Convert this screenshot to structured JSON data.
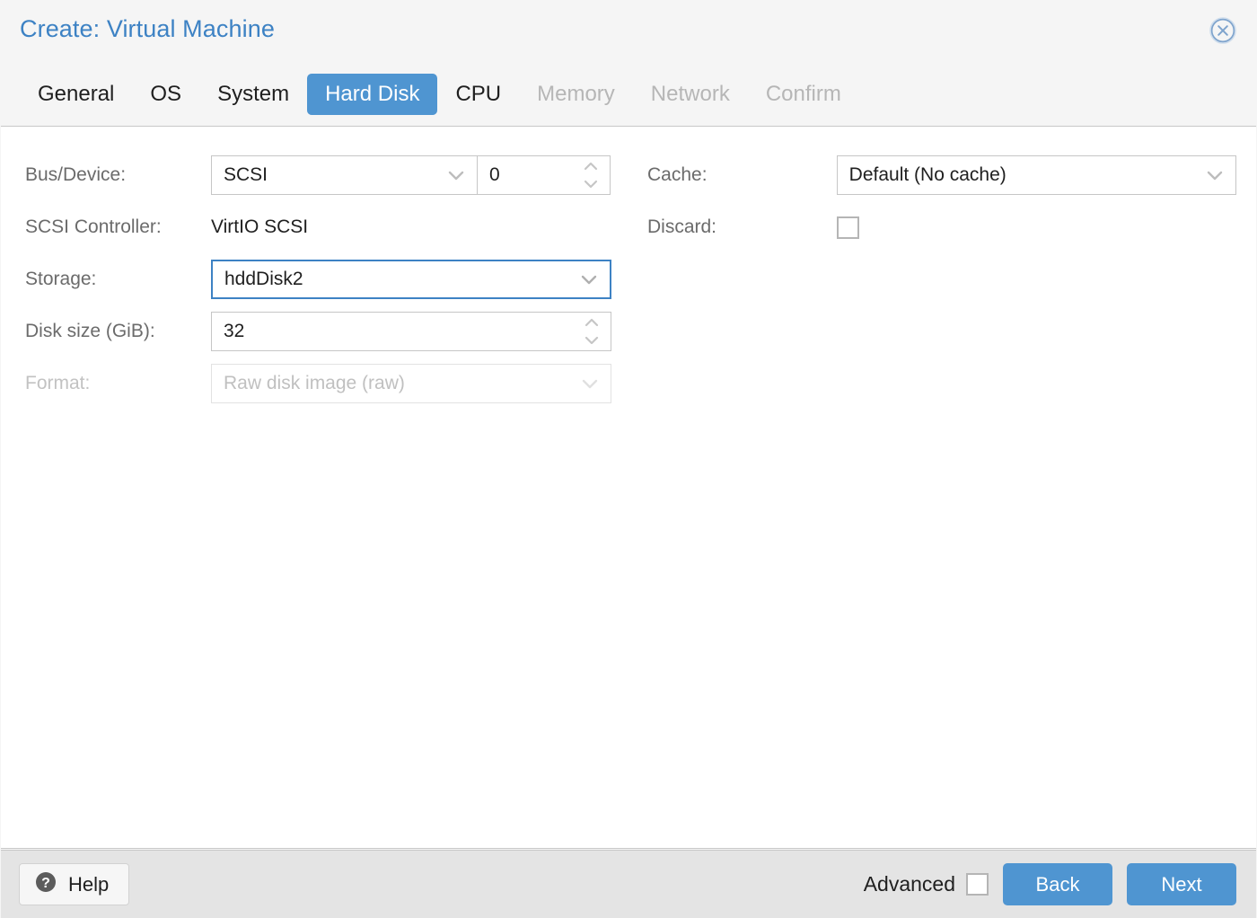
{
  "window": {
    "title": "Create: Virtual Machine",
    "close_icon": "close-circle-icon"
  },
  "tabs": [
    {
      "label": "General",
      "state": "enabled"
    },
    {
      "label": "OS",
      "state": "enabled"
    },
    {
      "label": "System",
      "state": "enabled"
    },
    {
      "label": "Hard Disk",
      "state": "selected"
    },
    {
      "label": "CPU",
      "state": "enabled"
    },
    {
      "label": "Memory",
      "state": "disabled"
    },
    {
      "label": "Network",
      "state": "disabled"
    },
    {
      "label": "Confirm",
      "state": "disabled"
    }
  ],
  "form": {
    "left": {
      "bus_device": {
        "label": "Bus/Device:",
        "bus_value": "SCSI",
        "device_value": "0"
      },
      "scsi_controller": {
        "label": "SCSI Controller:",
        "value": "VirtIO SCSI"
      },
      "storage": {
        "label": "Storage:",
        "value": "hddDisk2"
      },
      "disk_size": {
        "label": "Disk size (GiB):",
        "value": "32"
      },
      "format": {
        "label": "Format:",
        "value": "Raw disk image (raw)"
      }
    },
    "right": {
      "cache": {
        "label": "Cache:",
        "value": "Default (No cache)"
      },
      "discard": {
        "label": "Discard:",
        "checked": false
      }
    }
  },
  "footer": {
    "help_label": "Help",
    "help_icon": "question-circle-icon",
    "advanced_label": "Advanced",
    "advanced_checked": false,
    "back_label": "Back",
    "next_label": "Next"
  },
  "colors": {
    "accent_blue": "#4f95d1",
    "title_blue": "#3d82c4",
    "focus_blue": "#3d82c4",
    "page_bg": "#f5f5f5",
    "panel_bg": "#ffffff",
    "footer_bg": "#e4e4e4",
    "label_gray": "#6b6b6b",
    "disabled_gray": "#c2c2c2"
  }
}
